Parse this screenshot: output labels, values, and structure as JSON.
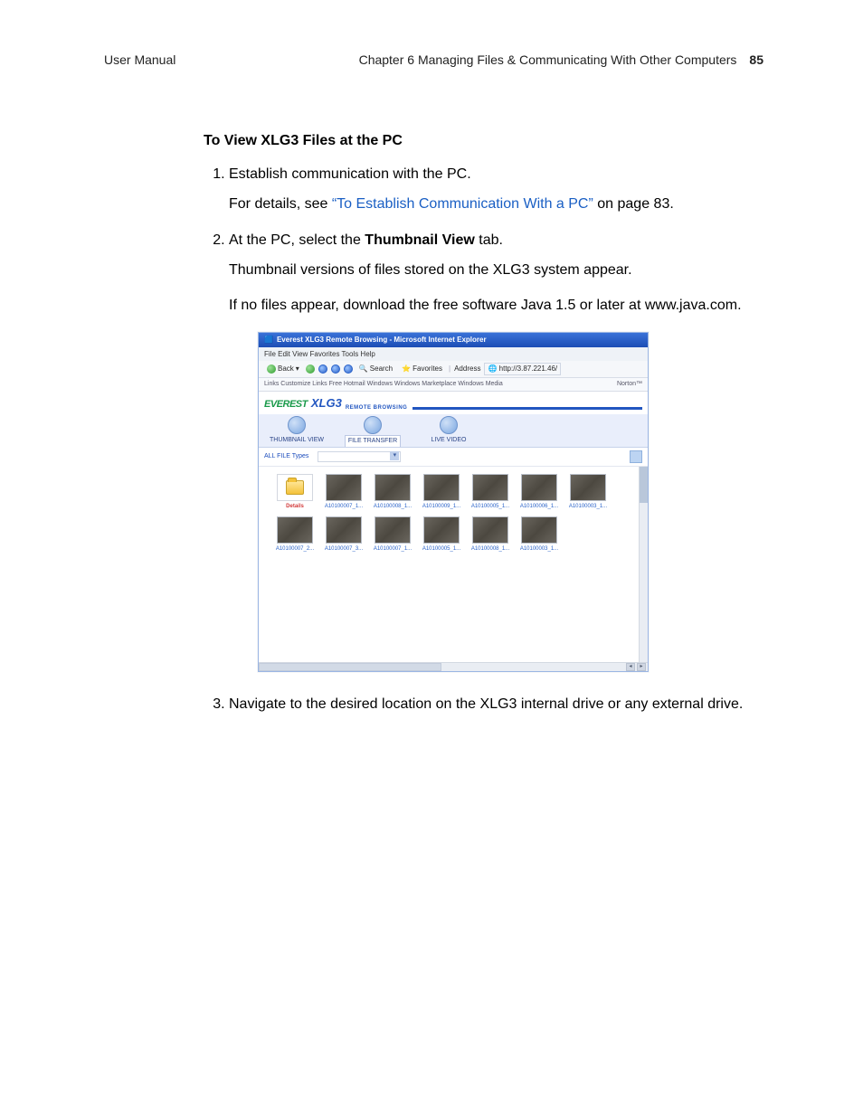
{
  "header": {
    "left": "User Manual",
    "chapter": "Chapter 6    Managing Files & Communicating With Other Computers",
    "page": "85"
  },
  "section_title": "To View XLG3 Files at the PC",
  "steps": {
    "s1_main": "Establish communication with the PC.",
    "s1_sub_pre": "For details, see ",
    "s1_sub_link": "“To Establish Communication With a PC”",
    "s1_sub_post": " on page 83.",
    "s2_pre": "At the PC, select the ",
    "s2_bold": "Thumbnail View",
    "s2_post": " tab.",
    "s2_sub1": "Thumbnail versions of files stored on the XLG3 system appear.",
    "s2_sub2": "If no files appear, download the free software Java 1.5 or later at www.java.com.",
    "s3_main": "Navigate to the desired location on the XLG3 internal drive or any external drive."
  },
  "screenshot": {
    "titlebar": "Everest XLG3 Remote Browsing - Microsoft Internet Explorer",
    "menubar": "File   Edit   View   Favorites   Tools   Help",
    "toolbar": {
      "back": "Back",
      "search": "Search",
      "favorites": "Favorites",
      "address_label": "Address",
      "address_value": "http://3.87.221.46/"
    },
    "linksbar_left": "Links   Customize Links   Free Hotmail   Windows   Windows Marketplace   Windows Media",
    "linksbar_right": "Norton™",
    "brand": {
      "everest": "EVEREST",
      "xlg3": "XLG3",
      "sub": "REMOTE BROWSING"
    },
    "tabs": [
      {
        "label": "THUMBNAIL VIEW"
      },
      {
        "label": "FILE TRANSFER"
      },
      {
        "label": "LIVE VIDEO"
      }
    ],
    "filter_label": "ALL FILE Types",
    "thumbs": [
      {
        "label": "Details",
        "folder": true
      },
      {
        "label": "A10100007_1..."
      },
      {
        "label": "A10100008_1..."
      },
      {
        "label": "A10100009_1..."
      },
      {
        "label": "A10100005_1..."
      },
      {
        "label": "A10100006_1..."
      },
      {
        "label": "A10100003_1..."
      },
      {
        "label": "A10100007_2..."
      },
      {
        "label": "A10100007_3..."
      },
      {
        "label": "A10100007_1..."
      },
      {
        "label": "A10100005_1..."
      },
      {
        "label": "A10100008_1..."
      },
      {
        "label": "A10100003_1..."
      }
    ]
  }
}
